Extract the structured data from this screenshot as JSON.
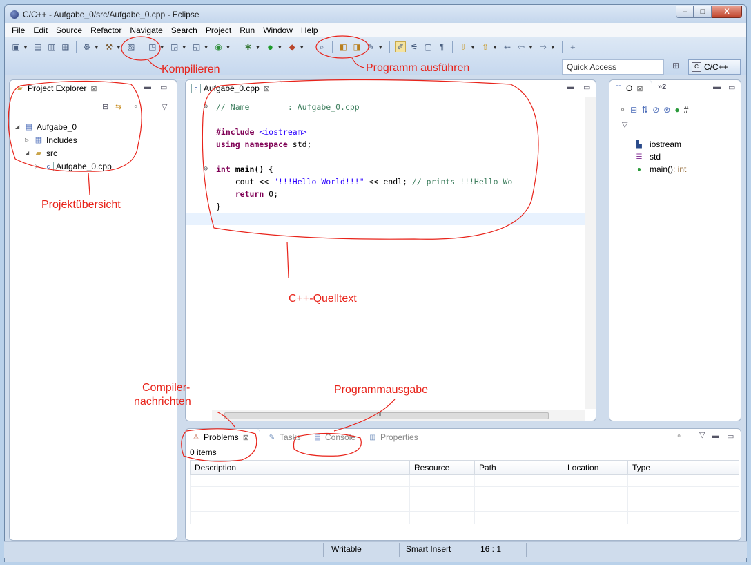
{
  "window": {
    "title": "C/C++ - Aufgabe_0/src/Aufgabe_0.cpp - Eclipse",
    "min": "–",
    "max": "□",
    "close": "X"
  },
  "menu": [
    "File",
    "Edit",
    "Source",
    "Refactor",
    "Navigate",
    "Search",
    "Project",
    "Run",
    "Window",
    "Help"
  ],
  "toolbar": {
    "quick_access": "Quick Access",
    "perspective": "C/C++"
  },
  "project_explorer": {
    "tab": "Project Explorer",
    "tree": [
      "Aufgabe_0",
      "Includes",
      "src",
      "Aufgabe_0.cpp"
    ]
  },
  "editor": {
    "tab": "Aufgabe_0.cpp",
    "lines": {
      "l1": "// Name        : Aufgabe_0.cpp",
      "l3a": "#include ",
      "l3b": "<iostream>",
      "l4a": "using namespace",
      "l4b": " std;",
      "l6a": "int",
      "l6b": " main() {",
      "l7a": "    cout << ",
      "l7b": "\"!!!Hello World!!!\"",
      "l7c": " << endl; ",
      "l7d": "// prints !!!Hello Wo",
      "l8a": "    ",
      "l8b": "return",
      "l8c": " 0;",
      "l9": "}"
    },
    "hscroll_label": "III"
  },
  "outline": {
    "tab": "O",
    "more": "»2",
    "items": [
      {
        "label": "iostream"
      },
      {
        "label": "std"
      },
      {
        "label": "main()",
        "type": " : int"
      }
    ]
  },
  "problems": {
    "tabs": [
      "Problems",
      "Tasks",
      "Console",
      "Properties"
    ],
    "count": "0 items",
    "columns": [
      "Description",
      "Resource",
      "Path",
      "Location",
      "Type"
    ]
  },
  "status": {
    "writable": "Writable",
    "insert": "Smart Insert",
    "position": "16 : 1"
  },
  "annotations": {
    "compile": "Kompilieren",
    "run": "Programm ausführen",
    "project": "Projektübersicht",
    "source": "C++-Quelltext",
    "compiler_line1": "Compiler-",
    "compiler_line2": "nachrichten",
    "output": "Programmausgabe"
  },
  "colors": {
    "annotation": "#e8231a",
    "keyword": "#7f0055",
    "string": "#2a00ff",
    "comment": "#3f7f5f"
  }
}
